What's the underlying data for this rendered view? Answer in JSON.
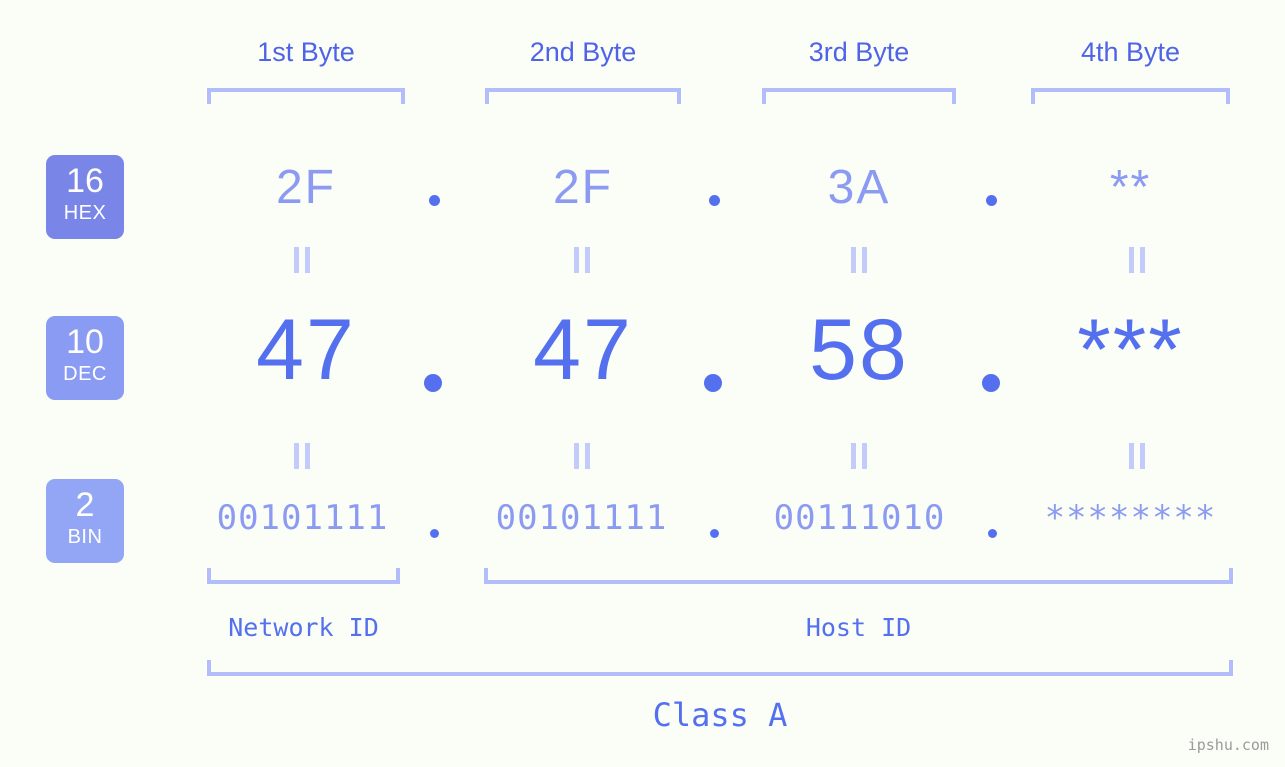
{
  "figure": {
    "background_color": "#fbfdf7",
    "accent_color": "#5570ef",
    "accent_light_color": "#8c9bf2",
    "bracket_color": "#b4bdfb"
  },
  "byte_headers": [
    {
      "label": "1st Byte"
    },
    {
      "label": "2nd Byte"
    },
    {
      "label": "3rd Byte"
    },
    {
      "label": "4th Byte"
    }
  ],
  "bases": [
    {
      "number": "16",
      "name": "HEX",
      "color": "#7986e8"
    },
    {
      "number": "10",
      "name": "DEC",
      "color": "#8a9bf3"
    },
    {
      "number": "2",
      "name": "BIN",
      "color": "#93a6f5"
    }
  ],
  "rows": {
    "hex": {
      "values": [
        "2F",
        "2F",
        "3A",
        "**"
      ]
    },
    "dec": {
      "values": [
        "47",
        "47",
        "58",
        "***"
      ]
    },
    "bin": {
      "values": [
        "00101111",
        "00101111",
        "00111010",
        "********"
      ]
    }
  },
  "equals_glyph": "=",
  "separator": ".",
  "sections": [
    {
      "label": "Network ID"
    },
    {
      "label": "Host ID"
    }
  ],
  "class_label": "Class A",
  "watermark": "ipshu.com"
}
